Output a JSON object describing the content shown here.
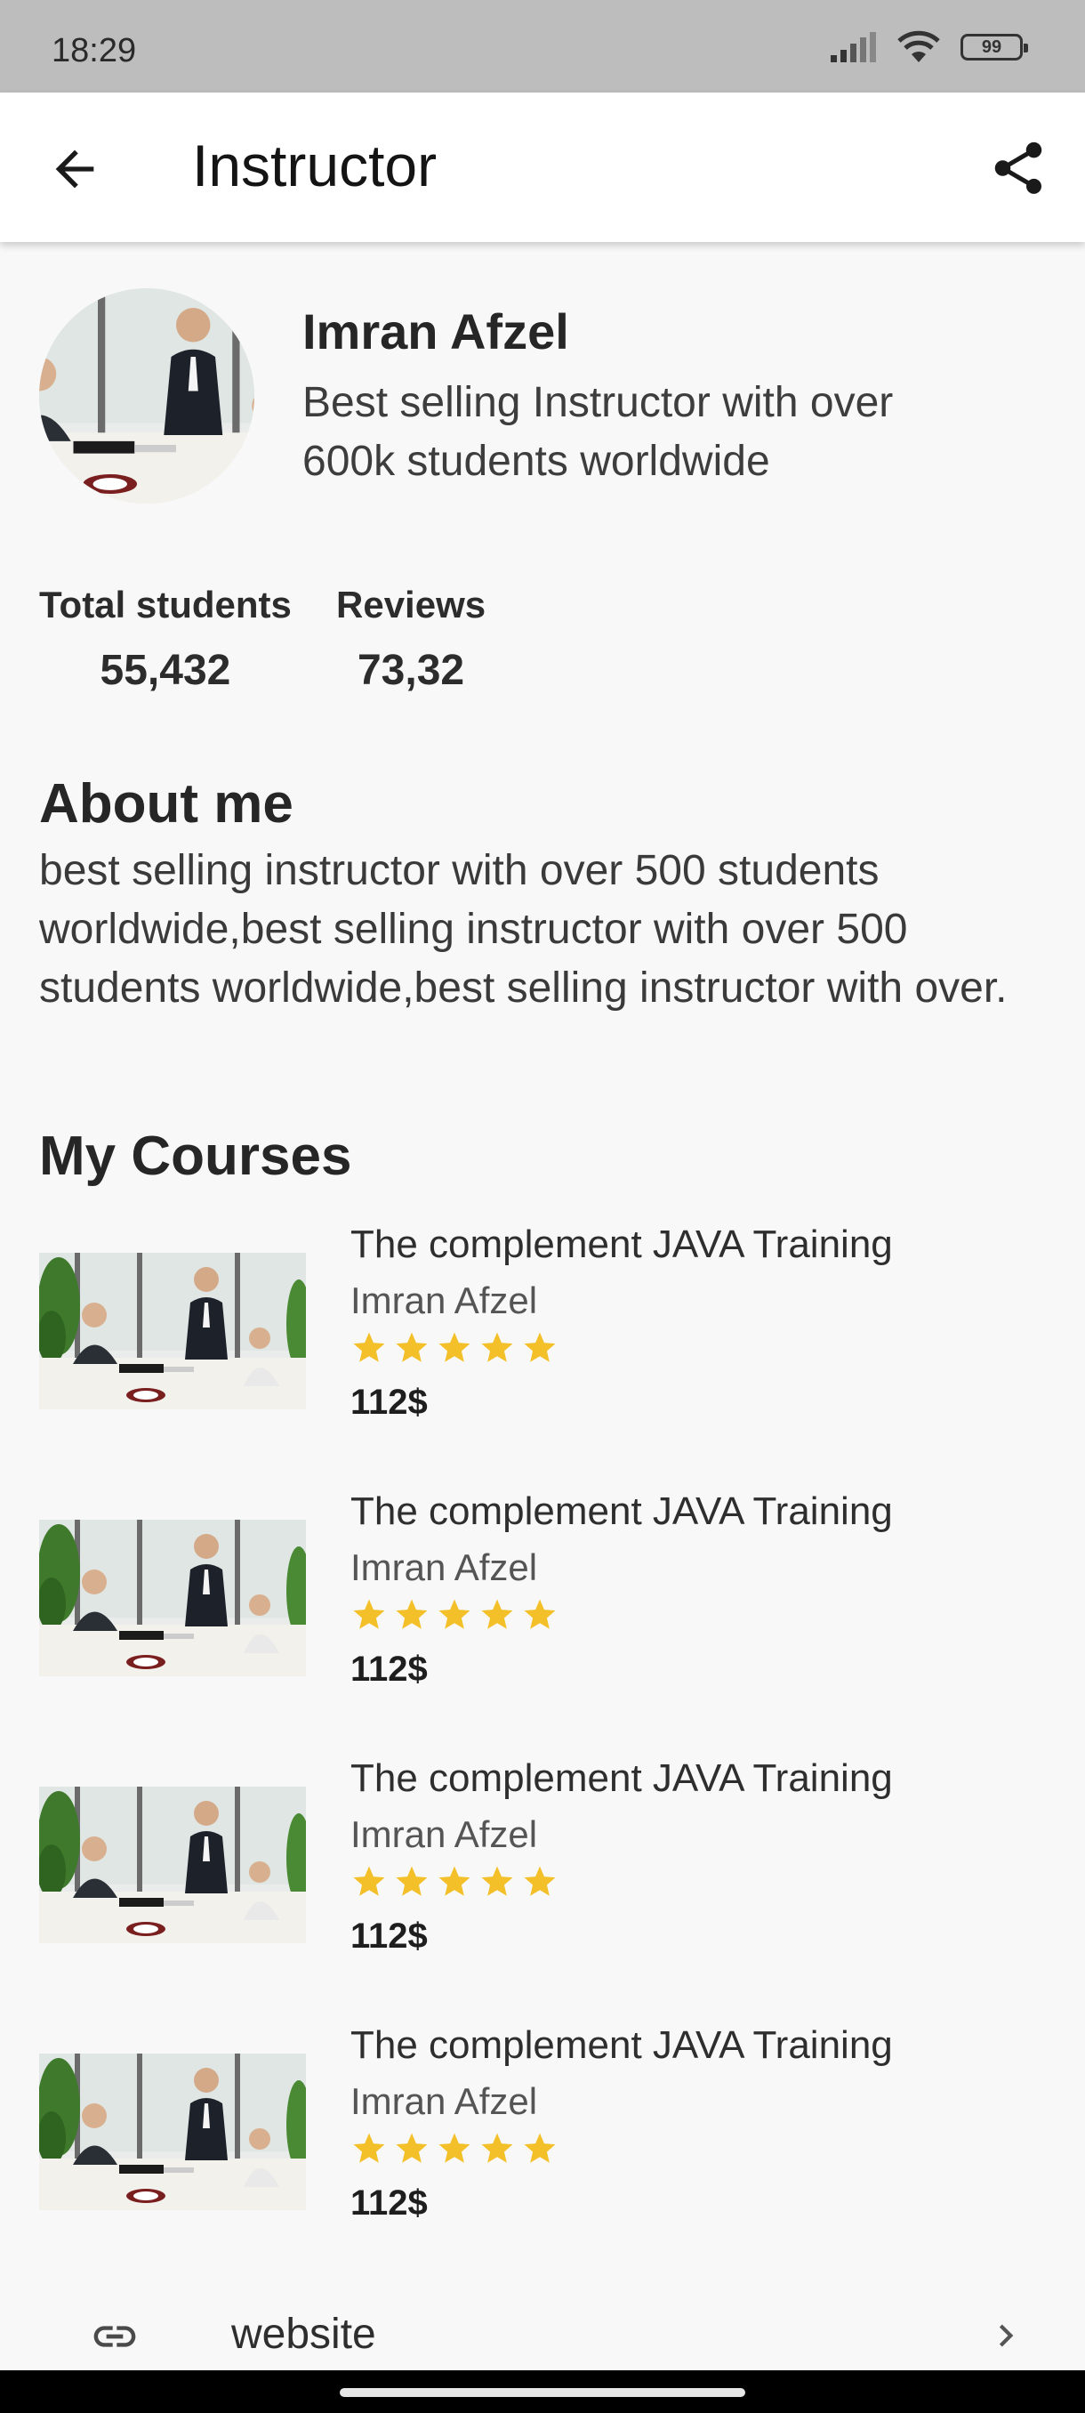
{
  "status_bar": {
    "time": "18:29",
    "battery": "99"
  },
  "app_bar": {
    "title": "Instructor"
  },
  "profile": {
    "name": "Imran Afzel",
    "tagline": "Best selling Instructor with over 600k students worldwide"
  },
  "stats": [
    {
      "label": "Total students",
      "value": "55,432"
    },
    {
      "label": "Reviews",
      "value": "73,32"
    }
  ],
  "about": {
    "heading": "About me",
    "text": "best selling instructor with over 500 students worldwide,best selling instructor with over 500 students worldwide,best selling instructor with over."
  },
  "courses_section": {
    "heading": "My Courses"
  },
  "courses": [
    {
      "title": "The complement JAVA Training",
      "author": "Imran Afzel",
      "rating": 5,
      "price": "112$"
    },
    {
      "title": "The complement JAVA Training",
      "author": "Imran Afzel",
      "rating": 5,
      "price": "112$"
    },
    {
      "title": "The complement JAVA Training",
      "author": "Imran Afzel",
      "rating": 5,
      "price": "112$"
    },
    {
      "title": "The complement JAVA Training",
      "author": "Imran Afzel",
      "rating": 5,
      "price": "112$"
    }
  ],
  "website": {
    "label": "website"
  },
  "colors": {
    "star": "#f4c02a",
    "status_bar": "#bdbdbd",
    "background": "#f8f8f8"
  },
  "icons": {
    "back": "arrow-left-icon",
    "share": "share-icon",
    "link": "link-icon",
    "chevron": "chevron-right-icon",
    "star": "star-icon"
  }
}
